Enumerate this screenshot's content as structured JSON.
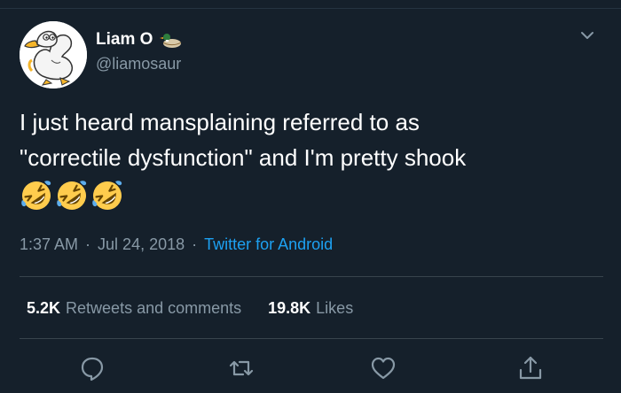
{
  "user": {
    "display_name": "Liam O",
    "handle": "@liamosaur",
    "avatar_icon": "white-duck-cartoon-icon",
    "badge_icon": "duck-emoji-icon"
  },
  "tweet": {
    "text_line1": "I just heard mansplaining referred to as",
    "text_line2": "\"correctile dysfunction\" and I'm pretty shook",
    "emojis": [
      "rolling-on-floor-laughing-emoji",
      "rolling-on-floor-laughing-emoji",
      "rolling-on-floor-laughing-emoji"
    ],
    "time": "1:37 AM",
    "date": "Jul 24, 2018",
    "separator": "·",
    "source": "Twitter for Android"
  },
  "stats": {
    "retweets_count": "5.2K",
    "retweets_label": "Retweets and comments",
    "likes_count": "19.8K",
    "likes_label": "Likes"
  },
  "actions": [
    "reply-icon",
    "retweet-icon",
    "like-icon",
    "share-icon"
  ],
  "colors": {
    "background": "#15202b",
    "text": "#ffffff",
    "secondary": "#8899a6",
    "link": "#1da1f2",
    "divider": "#38444d"
  }
}
